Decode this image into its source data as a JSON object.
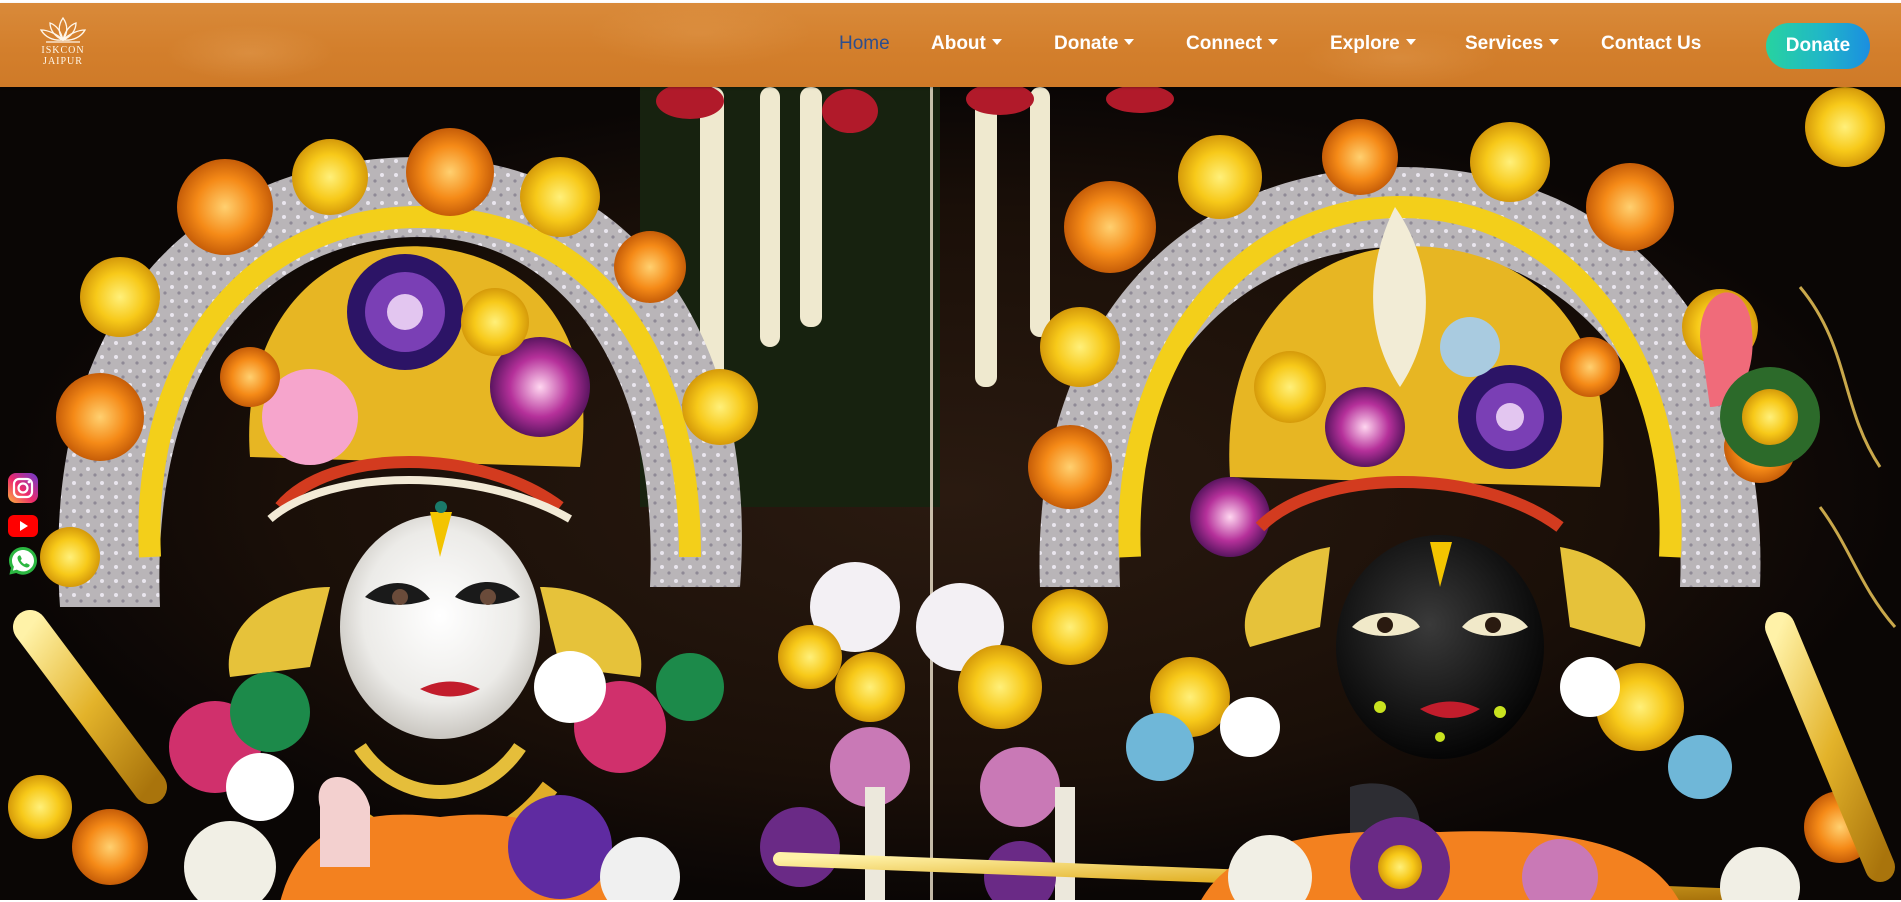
{
  "brand": {
    "logo_line1": "ISKCON",
    "logo_line2": "JAIPUR"
  },
  "nav": {
    "items": [
      {
        "label": "Home",
        "active": true,
        "dropdown": false
      },
      {
        "label": "About",
        "active": false,
        "dropdown": true
      },
      {
        "label": "Donate",
        "active": false,
        "dropdown": true
      },
      {
        "label": "Connect",
        "active": false,
        "dropdown": true
      },
      {
        "label": "Explore",
        "active": false,
        "dropdown": true
      },
      {
        "label": "Services",
        "active": false,
        "dropdown": true
      },
      {
        "label": "Contact Us",
        "active": false,
        "dropdown": false
      }
    ],
    "cta_label": "Donate"
  },
  "social": [
    {
      "icon": "instagram-icon"
    },
    {
      "icon": "youtube-icon"
    },
    {
      "icon": "whatsapp-icon"
    }
  ],
  "colors": {
    "navbar": "#d37f2c",
    "active_link": "#2c4e8e",
    "cta_gradient_start": "#27d3a0",
    "cta_gradient_end": "#1b8ee0"
  }
}
